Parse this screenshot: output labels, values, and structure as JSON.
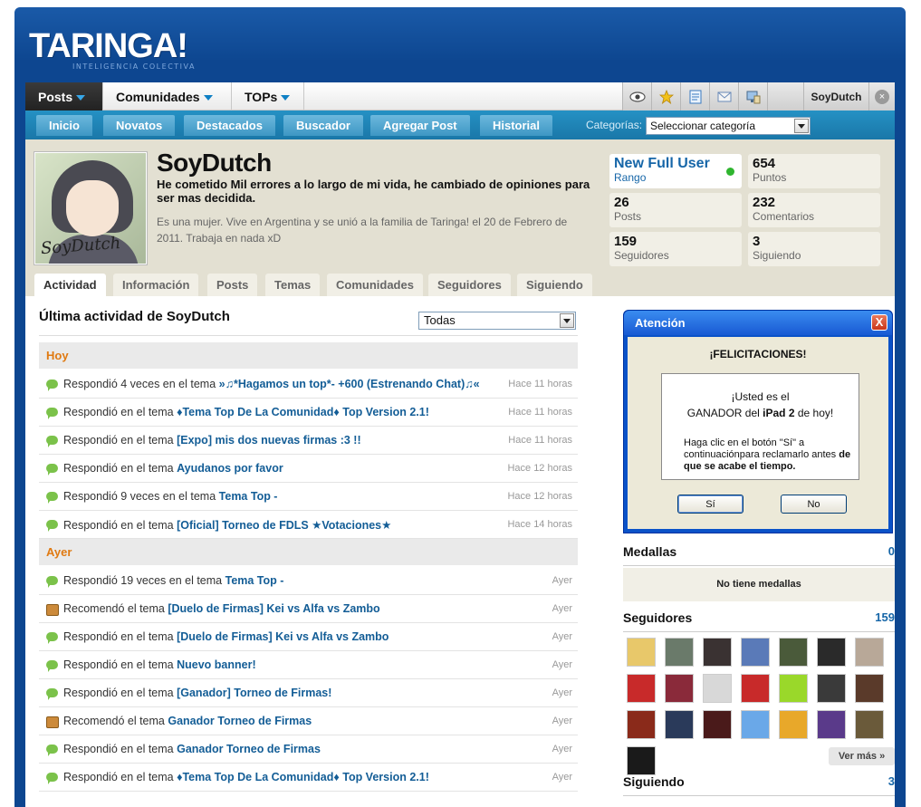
{
  "header": {
    "logo": "TARINGA!",
    "logo_tagline": "INTELIGENCIA COLECTIVA"
  },
  "topnav": {
    "tabs": [
      {
        "label": "Posts"
      },
      {
        "label": "Comunidades"
      },
      {
        "label": "TOPs"
      }
    ],
    "tools": [
      "eye-icon",
      "star-icon",
      "document-icon",
      "mail-icon",
      "monitor-icon"
    ],
    "username": "SoyDutch",
    "close": "×"
  },
  "subnav": {
    "items": [
      "Inicio",
      "Novatos",
      "Destacados",
      "Buscador",
      "Agregar Post",
      "Historial"
    ],
    "categories_label": "Categorías:",
    "categories_value": "Seleccionar categoría"
  },
  "profile": {
    "name": "SoyDutch",
    "quote": "He cometido Mil errores a lo largo de mi vida, he cambiado de opiniones para ser mas decidida.",
    "description": "Es una mujer. Vive en Argentina y se unió a la familia de Taringa! el 20 de Febrero de 2011. Trabaja en nada xD",
    "avatar_signature": "SoyDutch",
    "stats": [
      {
        "num": "New Full User",
        "label": "Rango"
      },
      {
        "num": "654",
        "label": "Puntos"
      },
      {
        "num": "26",
        "label": "Posts"
      },
      {
        "num": "232",
        "label": "Comentarios"
      },
      {
        "num": "159",
        "label": "Seguidores"
      },
      {
        "num": "3",
        "label": "Siguiendo"
      }
    ],
    "tabs": [
      "Actividad",
      "Información",
      "Posts",
      "Temas",
      "Comunidades",
      "Seguidores",
      "Siguiendo"
    ]
  },
  "activity": {
    "title": "Última actividad de SoyDutch",
    "filter": "Todas",
    "days": [
      {
        "label": "Hoy",
        "rows": [
          {
            "icon": "comment-icon",
            "prefix": "Respondió 4 veces en el tema",
            "link": "»♫*Hagamos un top*- +600 (Estrenando Chat)♫«",
            "time": "Hace 11 horas"
          },
          {
            "icon": "comment-icon",
            "prefix": "Respondió en el tema",
            "link": "♦Tema Top De La Comunidad♦ Top Version 2.1!",
            "time": "Hace 11 horas"
          },
          {
            "icon": "comment-icon",
            "prefix": "Respondió en el tema",
            "link": "[Expo] mis dos nuevas firmas :3 !!",
            "time": "Hace 11 horas"
          },
          {
            "icon": "comment-icon",
            "prefix": "Respondió en el tema",
            "link": "Ayudanos por favor",
            "time": "Hace 12 horas"
          },
          {
            "icon": "comment-icon",
            "prefix": "Respondió 9 veces en el tema",
            "link": "Tema Top -",
            "time": "Hace 12 horas"
          },
          {
            "icon": "comment-icon",
            "prefix": "Respondió en el tema",
            "link": "[Oficial] Torneo de FDLS ★Votaciones★",
            "time": "Hace 14 horas"
          }
        ]
      },
      {
        "label": "Ayer",
        "rows": [
          {
            "icon": "comment-icon",
            "prefix": "Respondió 19 veces en el tema",
            "link": "Tema Top -",
            "time": "Ayer"
          },
          {
            "icon": "recommend-icon",
            "prefix": "Recomendó el tema",
            "link": "[Duelo de Firmas] Kei vs Alfa vs Zambo",
            "time": "Ayer"
          },
          {
            "icon": "comment-icon",
            "prefix": "Respondió en el tema",
            "link": "[Duelo de Firmas] Kei vs Alfa vs Zambo",
            "time": "Ayer"
          },
          {
            "icon": "comment-icon",
            "prefix": "Respondió en el tema",
            "link": "Nuevo banner!",
            "time": "Ayer"
          },
          {
            "icon": "comment-icon",
            "prefix": "Respondió en el tema",
            "link": "[Ganador] Torneo de Firmas!",
            "time": "Ayer"
          },
          {
            "icon": "recommend-icon",
            "prefix": "Recomendó el tema",
            "link": "Ganador Torneo de Firmas",
            "time": "Ayer"
          },
          {
            "icon": "comment-icon",
            "prefix": "Respondió en el tema",
            "link": "Ganador Torneo de Firmas",
            "time": "Ayer"
          },
          {
            "icon": "comment-icon",
            "prefix": "Respondió en el tema",
            "link": "♦Tema Top De La Comunidad♦ Top Version 2.1!",
            "time": "Ayer"
          }
        ]
      }
    ]
  },
  "dialog": {
    "title": "Atención",
    "close": "X",
    "headline": "¡FELICITACIONES!",
    "line1": "¡Usted es el",
    "line2_pre": "GANADOR del ",
    "line2_bold": "iPad 2",
    "line2_post": " de hoy!",
    "line3_pre": "Haga clic en el botón \"Sí\" a continuaciónpara reclamarlo antes ",
    "line3_bold": "de que se acabe el tiempo.",
    "yes": "Sí",
    "no": "No"
  },
  "sidebar": {
    "medals_title": "Medallas",
    "medals_count": "0",
    "no_medals": "No tiene medallas",
    "followers_title": "Seguidores",
    "followers_count": "159",
    "followers_avatars": [
      "#e8c86a",
      "#6a7a6a",
      "#3a3232",
      "#5a7ab8",
      "#4a5a3a",
      "#2a2a2a",
      "#b8a898",
      "#c82a2a",
      "#8a2a3a",
      "#d8d8d8",
      "#c82a2a",
      "#9ad82a",
      "#3a3a3a",
      "#5a3a2a",
      "#8a2a1a",
      "#2a3a5a",
      "#4a1a1a",
      "#6aa8e8",
      "#e8a82a",
      "#5a3a8a",
      "#6a5a3a",
      "#1a1a1a"
    ],
    "see_more": "Ver más »",
    "following_title": "Siguiendo",
    "following_count": "3"
  }
}
